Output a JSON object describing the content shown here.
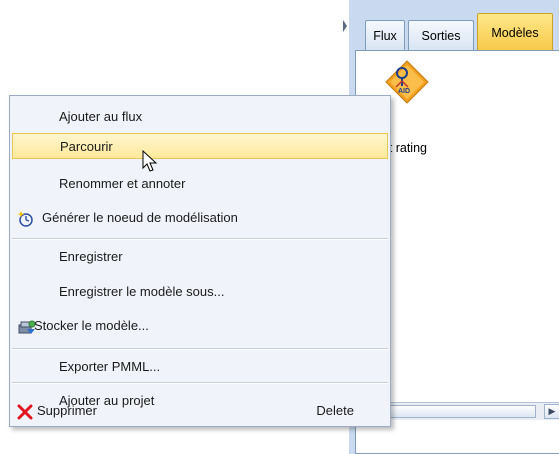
{
  "palette": {
    "tabs": [
      "Flux",
      "Sorties",
      "Modèles"
    ],
    "active_tab": "Modèles",
    "model_badge": "AID",
    "model_caption": "it rating",
    "scroll_arrow": "▶"
  },
  "menu": {
    "items": [
      {
        "label": "Ajouter au flux"
      },
      {
        "label": "Parcourir"
      },
      {
        "label": "Renommer et annoter"
      },
      {
        "label": "Générer le noeud de modélisation",
        "icon": "generate-wand-icon"
      },
      {
        "label": "Enregistrer"
      },
      {
        "label": "Enregistrer le modèle sous..."
      },
      {
        "label": "Stocker le modèle...",
        "icon": "store-model-icon"
      },
      {
        "label": "Exporter PMML..."
      },
      {
        "label": "Ajouter au projet"
      },
      {
        "label": "Supprimer",
        "icon": "delete-x-icon",
        "shortcut": "Delete"
      }
    ],
    "highlighted_index": 1
  },
  "colors": {
    "panel_bg": "#c9daf0",
    "menu_bg": "#f0f4fa",
    "highlight": "#ffe99a",
    "active_tab": "#f7c948",
    "delete_red": "#e0141e"
  }
}
